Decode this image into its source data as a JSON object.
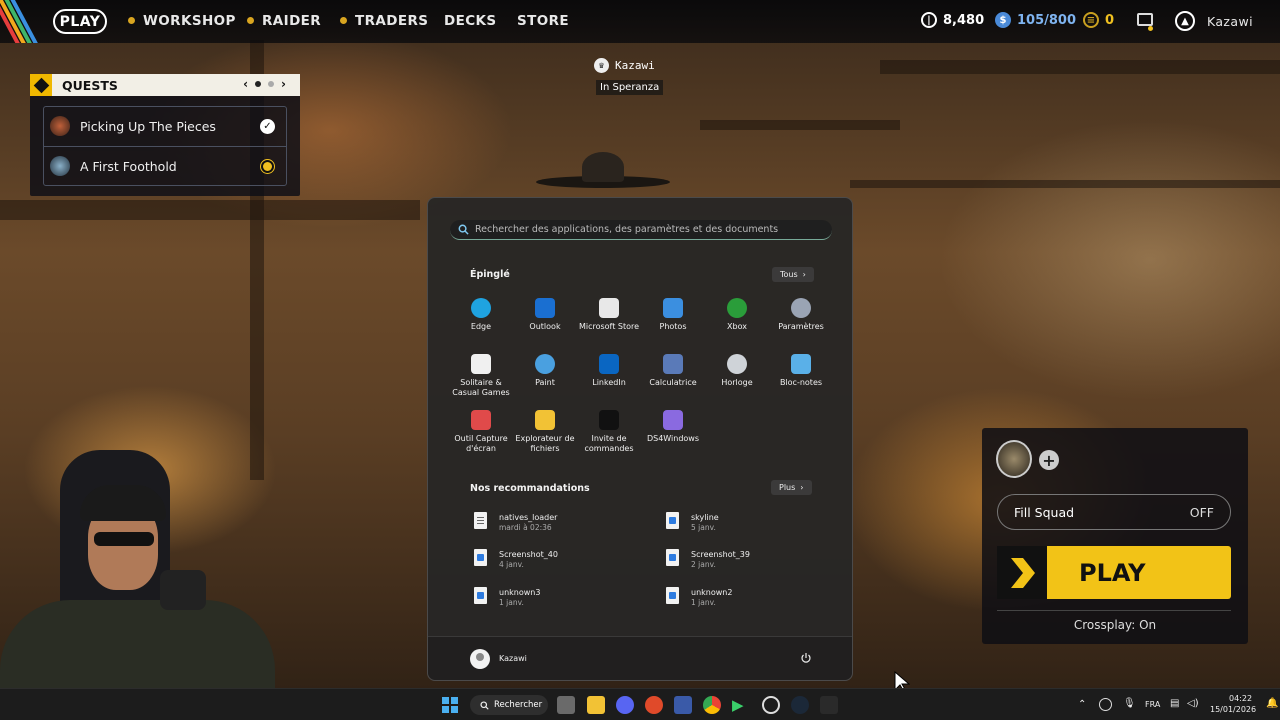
{
  "nav": {
    "play": "PLAY",
    "items": [
      "WORKSHOP",
      "RAIDER",
      "TRADERS",
      "DECKS",
      "STORE"
    ],
    "currency_1": "8,480",
    "currency_2": "105/800",
    "currency_3": "0",
    "username": "Kazawi"
  },
  "quests": {
    "title": "QUESTS",
    "items": [
      {
        "name": "Picking Up The Pieces",
        "status": "complete"
      },
      {
        "name": "A First Foothold",
        "status": "active"
      }
    ]
  },
  "player_tag": {
    "name": "Kazawi",
    "location": "In Speranza"
  },
  "start_menu": {
    "search_placeholder": "Rechercher des applications, des paramètres et des documents",
    "pinned_title": "Épinglé",
    "all_button": "Tous",
    "apps": [
      {
        "label": "Edge",
        "icon": "edge-icon",
        "color": "#1fa3e0"
      },
      {
        "label": "Outlook",
        "icon": "outlook-icon",
        "color": "#1a6fd1"
      },
      {
        "label": "Microsoft Store",
        "icon": "store-icon",
        "color": "#e8e8e8"
      },
      {
        "label": "Photos",
        "icon": "photos-icon",
        "color": "#3b8fe0"
      },
      {
        "label": "Xbox",
        "icon": "xbox-icon",
        "color": "#2a9d3a"
      },
      {
        "label": "Paramètres",
        "icon": "settings-icon",
        "color": "#9aa4b4"
      },
      {
        "label": "Solitaire & Casual Games",
        "icon": "solitaire-icon",
        "color": "#f0f0f0"
      },
      {
        "label": "Paint",
        "icon": "paint-icon",
        "color": "#4aa0e0"
      },
      {
        "label": "LinkedIn",
        "icon": "linkedin-icon",
        "color": "#0a66c2"
      },
      {
        "label": "Calculatrice",
        "icon": "calculator-icon",
        "color": "#5a7ab8"
      },
      {
        "label": "Horloge",
        "icon": "clock-icon",
        "color": "#cfd3d8"
      },
      {
        "label": "Bloc-notes",
        "icon": "notepad-icon",
        "color": "#5ab0e8"
      },
      {
        "label": "Outil Capture d'écran",
        "icon": "snipping-tool-icon",
        "color": "#e04a4a"
      },
      {
        "label": "Explorateur de fichiers",
        "icon": "file-explorer-icon",
        "color": "#f2c235"
      },
      {
        "label": "Invite de commandes",
        "icon": "command-prompt-icon",
        "color": "#111111"
      },
      {
        "label": "DS4Windows",
        "icon": "gamepad-icon",
        "color": "#8a6ae0"
      }
    ],
    "recommended_title": "Nos recommandations",
    "more_button": "Plus",
    "recommended": [
      {
        "name": "natives_loader",
        "date": "mardi à 02:36",
        "type": "doc"
      },
      {
        "name": "skyline",
        "date": "5 janv.",
        "type": "img"
      },
      {
        "name": "Screenshot_40",
        "date": "4 janv.",
        "type": "img"
      },
      {
        "name": "Screenshot_39",
        "date": "2 janv.",
        "type": "img"
      },
      {
        "name": "unknown3",
        "date": "1 janv.",
        "type": "img"
      },
      {
        "name": "unknown2",
        "date": "1 janv.",
        "type": "img"
      }
    ],
    "user": "Kazawi"
  },
  "play_panel": {
    "fill_squad_label": "Fill Squad",
    "fill_squad_value": "OFF",
    "play_label": "PLAY",
    "crossplay": "Crossplay: On",
    "add_symbol": "+"
  },
  "taskbar": {
    "search_label": "Rechercher",
    "language": "FRA",
    "time": "04:22",
    "date": "15/01/2026"
  }
}
